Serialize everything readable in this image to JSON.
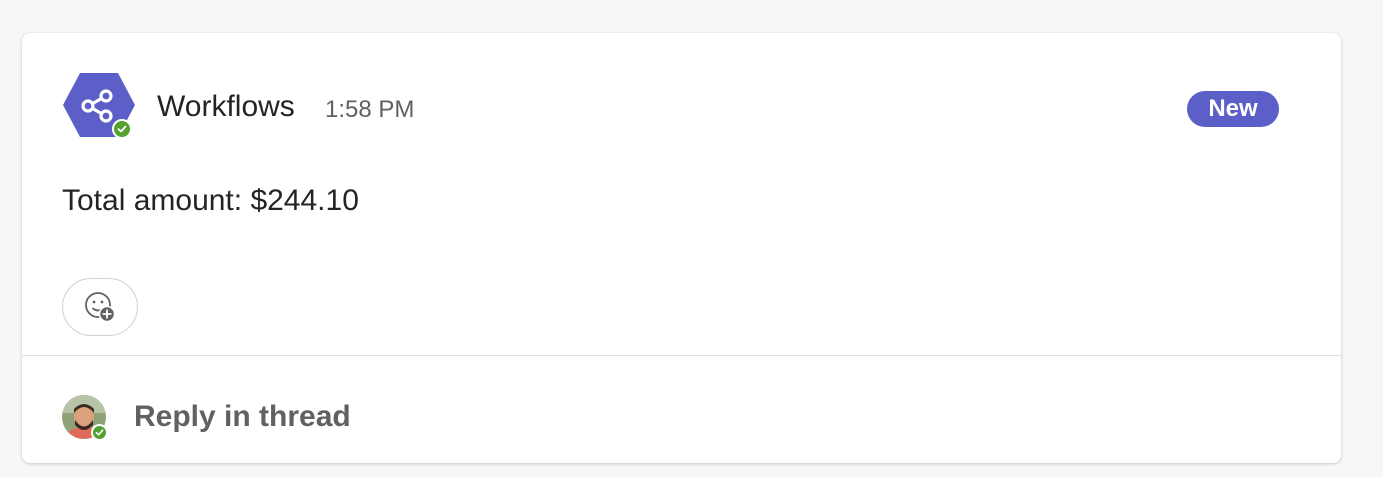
{
  "message": {
    "sender": "Workflows",
    "timestamp": "1:58 PM",
    "badge": "New",
    "body": "Total amount: $244.10"
  },
  "reply": {
    "label": "Reply in thread"
  },
  "colors": {
    "accent": "#5b5fc7",
    "presence_available": "#53a12f"
  },
  "icons": {
    "app": "workflows-share-icon",
    "reaction": "add-reaction-icon",
    "presence": "checkmark-icon"
  }
}
